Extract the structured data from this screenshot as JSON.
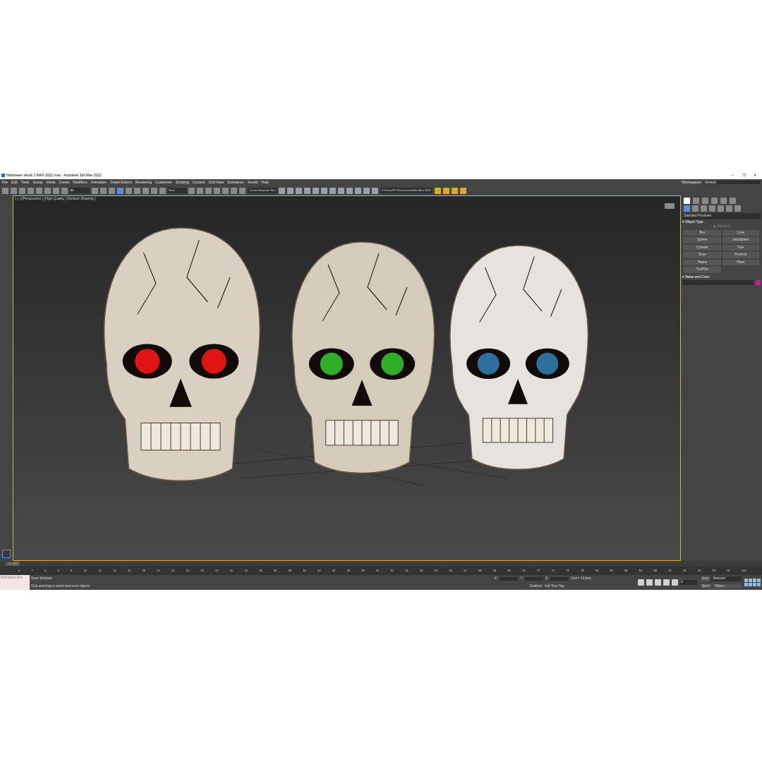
{
  "window": {
    "title": "Halloween skulls 2 MAX 2022.max - Autodesk 3ds Max 2022",
    "controls": [
      "─",
      "❐",
      "✕"
    ]
  },
  "menu": {
    "items": [
      "File",
      "Edit",
      "Tools",
      "Group",
      "Views",
      "Create",
      "Modifiers",
      "Animation",
      "Graph Editors",
      "Rendering",
      "Customize",
      "Scripting",
      "Content",
      "Civil View",
      "Substance",
      "Arnold",
      "Help"
    ],
    "workspaces_label": "Workspaces:",
    "workspace": "Default"
  },
  "toolbar": {
    "filter": "All",
    "coord": "View",
    "selection_set": "Create Selection Set",
    "path": "C:\\Users\\PC\\Documents\\3ds Max 2022"
  },
  "viewport": {
    "label": "[ + ] [Perspective ] [High Quality ] [Default Shading ]",
    "skulls": [
      {
        "color": "#e01414",
        "tint": "#d9d0c2"
      },
      {
        "color": "#2fae2a",
        "tint": "#d4cbbb"
      },
      {
        "color": "#2f6f9e",
        "tint": "#e6e3de"
      }
    ]
  },
  "command_panel": {
    "category": "Standard Primitives",
    "object_type_title": "Object Type",
    "autogrid": {
      "label": "AutoGrid",
      "checked": false
    },
    "buttons": [
      "Box",
      "Cone",
      "Sphere",
      "GeoSphere",
      "Cylinder",
      "Tube",
      "Torus",
      "Pyramid",
      "Teapot",
      "Plane",
      "TextPlus"
    ],
    "name_color_title": "Name and Color",
    "swatch": "#c0208c"
  },
  "timeline": {
    "frame": "0 / 100",
    "ticks": [
      "0",
      "2",
      "4",
      "6",
      "8",
      "10",
      "12",
      "14",
      "16",
      "18",
      "20",
      "22",
      "24",
      "26",
      "28",
      "30",
      "32",
      "34",
      "36",
      "38",
      "40",
      "42",
      "44",
      "46",
      "48",
      "50",
      "52",
      "54",
      "56",
      "58",
      "60",
      "62",
      "64",
      "66",
      "68",
      "70",
      "72",
      "74",
      "76",
      "78",
      "80",
      "82",
      "84",
      "86",
      "88",
      "90",
      "92",
      "94",
      "96",
      "98",
      "100"
    ]
  },
  "status_bar": {
    "maxscript": "MAXScript Mini",
    "selection": "None Selected",
    "prompt": "Click and drag to select and move objects",
    "x_label": "X:",
    "y_label": "Y:",
    "z_label": "Z:",
    "grid": "Grid = 10,0cm",
    "enabled": "Enabled:",
    "time_tag": "Add Time Tag",
    "auto": "Auto",
    "key_mode": "Selected",
    "set_key": "Set K.",
    "filters": "Filters...",
    "current_frame": "0"
  }
}
